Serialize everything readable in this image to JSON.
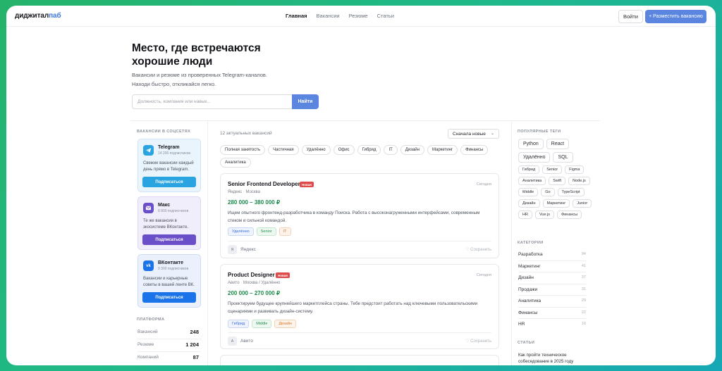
{
  "header": {
    "logo_main": "диджитал",
    "logo_accent": "паб",
    "nav": [
      "Главная",
      "Вакансии",
      "Резюме",
      "Статьи"
    ],
    "login_label": "Войти",
    "post_label": "+ Разместить вакансию"
  },
  "hero": {
    "title": "Место, где встречаются хорошие люди",
    "subtitle_1": "Вакансии и резюме из проверенных Telegram-каналов.",
    "subtitle_2": "Находи быстро, откликайся легко.",
    "search_placeholder": "Должность, компания или навык...",
    "search_button": "Найти"
  },
  "sidebar": {
    "social_title": "ВАКАНСИИ В СОЦСЕТЯХ",
    "socials": [
      {
        "name": "Telegram",
        "subs": "14 200 подписчиков",
        "desc": "Свежие вакансии каждый день прямо в Telegram.",
        "button": "Подписаться",
        "icon": "telegram-icon",
        "color": "#2aa4e0"
      },
      {
        "name": "Макс",
        "subs": "8 800 подписчиков",
        "desc": "Те же вакансии в экосистеме ВКонтакте.",
        "button": "Подписаться",
        "icon": "max-icon",
        "color": "#6a4fc9"
      },
      {
        "name": "ВКонтакте",
        "subs": "9 300 подписчиков",
        "desc": "Вакансии и карьерные советы в вашей ленте ВК.",
        "button": "Подписаться",
        "icon": "vk-icon",
        "color": "#1a73e8"
      }
    ],
    "platform_title": "ПЛАТФОРМА",
    "stats": [
      {
        "label": "Вакансий",
        "value": "248"
      },
      {
        "label": "Резюме",
        "value": "1 204"
      },
      {
        "label": "Компаний",
        "value": "87"
      }
    ]
  },
  "main": {
    "count_text": "12 актуальных вакансий",
    "sort_value": "Сначала новые",
    "filters": [
      "Полная занятость",
      "Частичная",
      "Удалённо",
      "Офис",
      "Гибрид",
      "IT",
      "Дизайн",
      "Маркетинг",
      "Финансы",
      "Аналитика"
    ],
    "jobs": [
      {
        "title": "Senior Frontend Developer",
        "badge": "Новая",
        "when": "Сегодня",
        "company": "Яндекс",
        "location": "Москва",
        "salary": "280 000 – 380 000 ₽",
        "desc": "Ищем опытного фронтенд-разработчика в команду Поиска. Работа с высоконагруженными интерфейсами, современным стеком и сильной командой.",
        "tags": [
          {
            "label": "Удалённо",
            "tone": "blue"
          },
          {
            "label": "Senior",
            "tone": "green"
          },
          {
            "label": "IT",
            "tone": "orange"
          }
        ],
        "avatar": "Я",
        "save_label": "♡ Сохранить"
      },
      {
        "title": "Product Designer",
        "badge": "Новая",
        "when": "Сегодня",
        "company": "Авито",
        "location": "Москва / Удалённо",
        "salary": "200 000 – 270 000 ₽",
        "desc": "Проектируем будущее крупнейшего маркетплейса страны. Тебе предстоит работать над ключевыми пользовательскими сценариями и развивать дизайн-систему.",
        "tags": [
          {
            "label": "Гибрид",
            "tone": "blue"
          },
          {
            "label": "Middle",
            "tone": "green"
          },
          {
            "label": "Дизайн",
            "tone": "orange"
          }
        ],
        "avatar": "А",
        "save_label": "♡ Сохранить"
      }
    ]
  },
  "right": {
    "tags_title": "ПОПУЛЯРНЫЕ ТЕГИ",
    "big_tags": [
      "Python",
      "React",
      "Удалённо",
      "SQL"
    ],
    "small_tags": [
      "Гибрид",
      "Senior",
      "Figma",
      "Аналитика",
      "Swift",
      "Node.js",
      "Middle",
      "Go",
      "TypeScript",
      "Дизайн",
      "Маркетинг",
      "Junior",
      "HR",
      "Vue.js",
      "Финансы"
    ],
    "categories_title": "КАТЕГОРИИ",
    "categories": [
      {
        "label": "Разработка",
        "count": "94"
      },
      {
        "label": "Маркетинг",
        "count": "41"
      },
      {
        "label": "Дизайн",
        "count": "37"
      },
      {
        "label": "Продажи",
        "count": "31"
      },
      {
        "label": "Аналитика",
        "count": "29"
      },
      {
        "label": "Финансы",
        "count": "22"
      },
      {
        "label": "HR",
        "count": "16"
      }
    ],
    "articles_title": "СТАТЬИ",
    "article_1": "Как пройти техническое собеседование в 2025 году"
  }
}
